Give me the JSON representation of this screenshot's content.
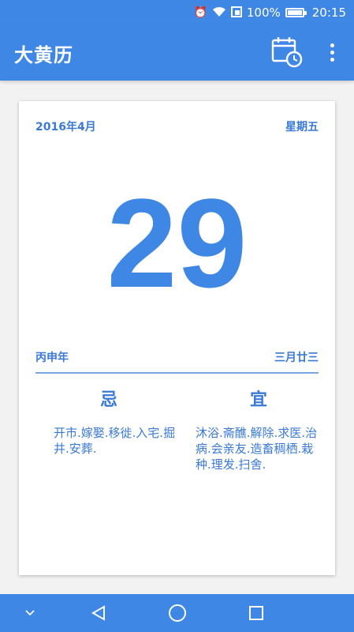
{
  "status": {
    "battery_percent": "100%",
    "time": "20:15"
  },
  "app_bar": {
    "title": "大黄历"
  },
  "card": {
    "year_month": "2016年4月",
    "weekday": "星期五",
    "day": "29",
    "ganzhi_year": "丙申年",
    "lunar_date": "三月廿三",
    "avoid_label": "忌",
    "avoid_text": "开市.嫁娶.移徙.入宅.掘井.安葬.",
    "suitable_label": "宜",
    "suitable_text": "沐浴.斋醮.解除.求医.治病.会亲友.造畜稠栖.栽种.理发.扫舍."
  },
  "colors": {
    "primary": "#3f87e5",
    "text_blue": "#3a7ad6"
  }
}
